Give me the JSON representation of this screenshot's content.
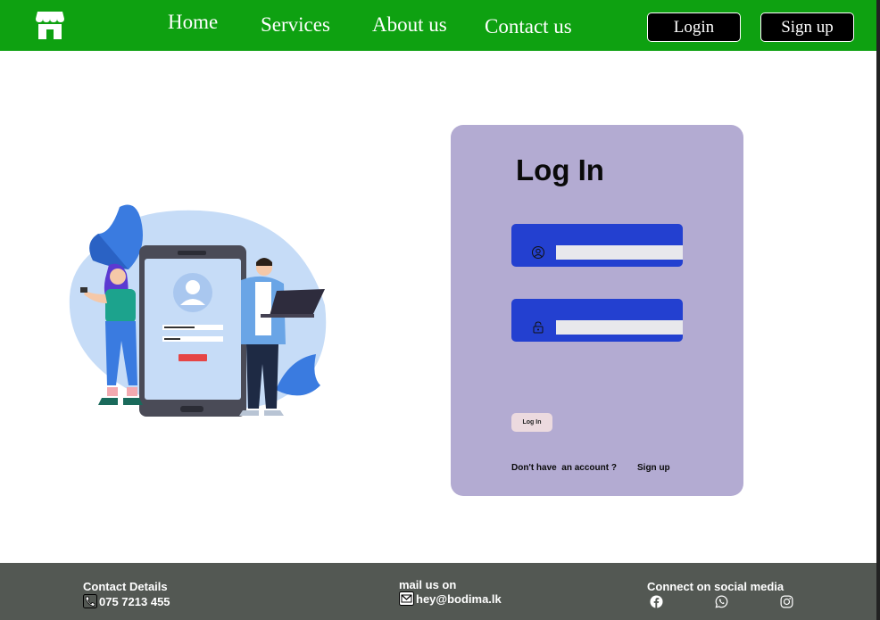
{
  "header": {
    "nav": [
      "Home",
      "Services",
      "About us",
      "Contact us"
    ],
    "login_label": "Login",
    "signup_label": "Sign up",
    "bg_color": "#0ea111"
  },
  "illustration": {
    "icon": "login-illustration"
  },
  "login_card": {
    "title": "Log In",
    "username": {
      "icon": "user-icon",
      "value": ""
    },
    "password": {
      "icon": "lock-icon",
      "value": ""
    },
    "button_label": "Log In",
    "no_account_text": "Don't have  an account ?",
    "signup_link": "Sign up",
    "bg_color": "#b3abd2",
    "field_color": "#2340d0"
  },
  "footer": {
    "contact_label": "Contact Details",
    "phone": "075 7213 455",
    "mail_label": "mail us on",
    "email": "hey@bodima.lk",
    "social_label": "Connect on social media",
    "social_icons": [
      "facebook-icon",
      "whatsapp-icon",
      "instagram-icon"
    ],
    "bg_color": "#535853"
  }
}
